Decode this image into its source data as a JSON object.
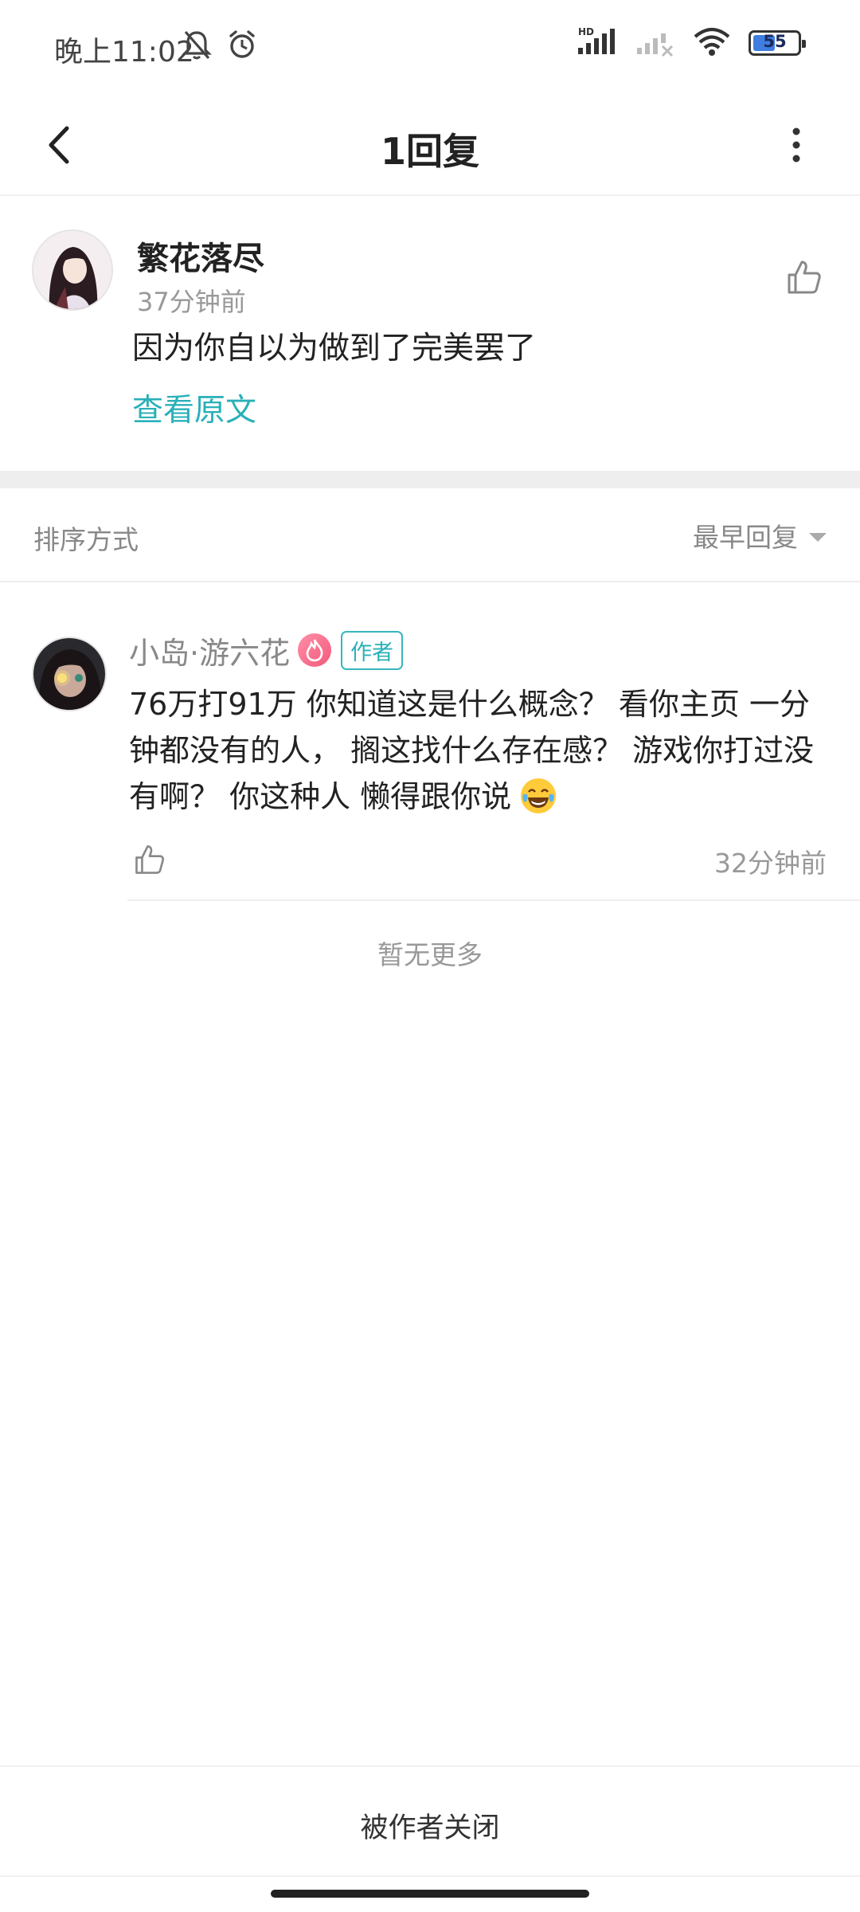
{
  "status_bar": {
    "time": "晚上11:02",
    "battery": "55",
    "battery_level": 0.55,
    "icons": [
      "mute-bell-icon",
      "alarm-icon",
      "hd-signal-icon",
      "no-signal-icon",
      "wifi-icon",
      "battery-icon"
    ]
  },
  "top_bar": {
    "title": "1回复",
    "back_icon": "chevron-left-icon",
    "more_icon": "more-vertical-icon"
  },
  "original_comment": {
    "username": "繁花落尽",
    "time": "37分钟前",
    "text": "因为你自以为做到了完美罢了",
    "view_original": "查看原文",
    "like_icon": "thumbs-up-icon"
  },
  "sort": {
    "label": "排序方式",
    "selected": "最早回复"
  },
  "reply": {
    "username": "小岛·游六花",
    "badge": "作者",
    "text": "76万打91万 你知道这是什么概念？ 看你主页 一分钟都没有的人， 搁这找什么存在感？ 游戏你打过没有啊？ 你这种人 懒得跟你说",
    "emoji": "laughing-tears-emoji",
    "time": "32分钟前",
    "like_icon": "thumbs-up-icon"
  },
  "no_more": "暂无更多",
  "bottom": {
    "closed_text": "被作者关闭"
  },
  "colors": {
    "accent": "#2ab0b8",
    "muted_text": "#999999",
    "primary_text": "#222222",
    "divider": "#eeeeee"
  }
}
